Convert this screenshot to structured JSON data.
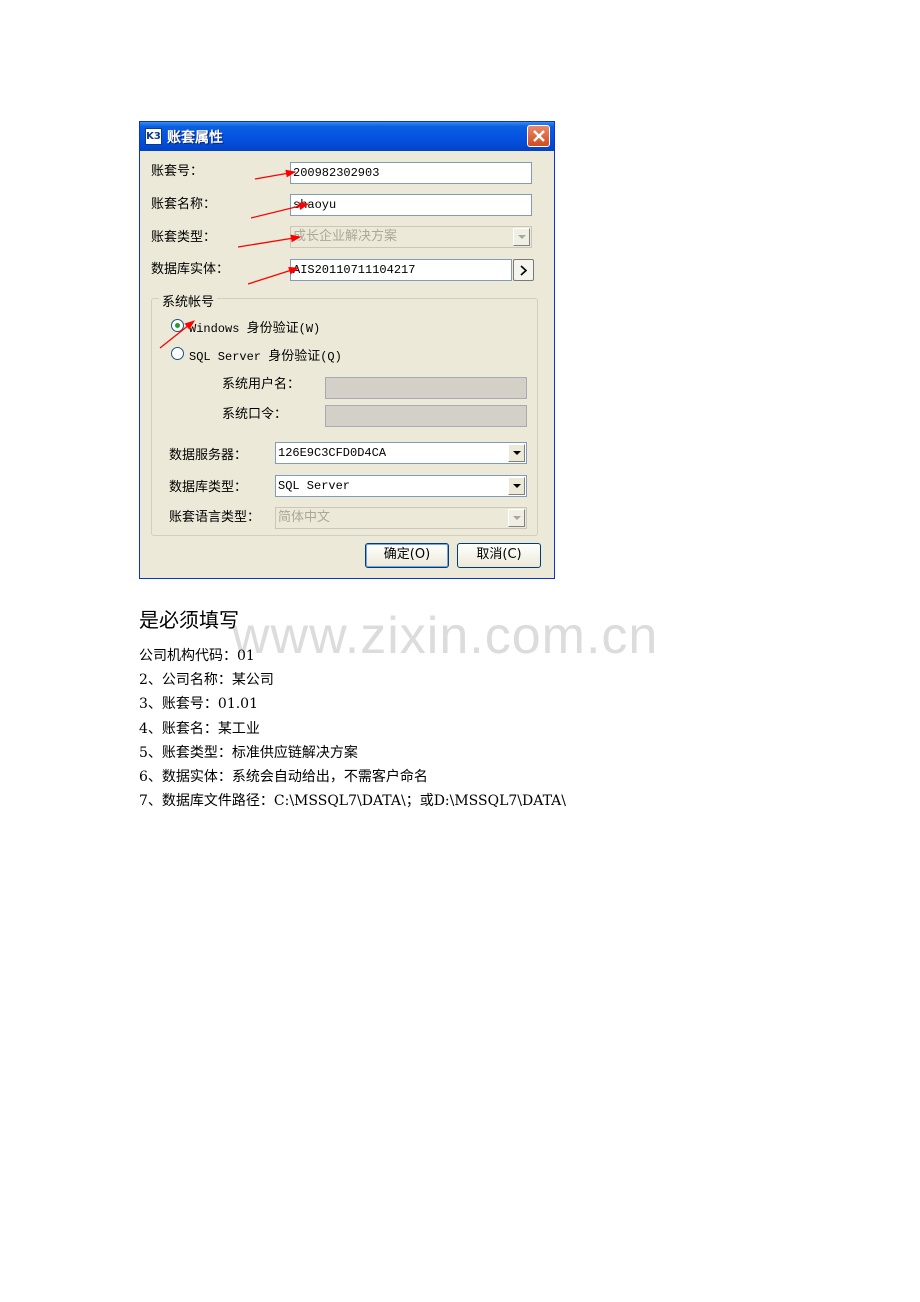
{
  "dialog": {
    "title": "账套属性",
    "app_icon_text": "K3",
    "colors": {
      "titlebar": "#0451e0",
      "close": "#d24a20",
      "body": "#ece9d8",
      "arrow": "#ff0000"
    },
    "fields": {
      "account_no_label": "账套号：",
      "account_no_value": "200982302903",
      "account_name_label": "账套名称：",
      "account_name_value": "shaoyu",
      "account_type_label": "账套类型：",
      "account_type_value": "成长企业解决方案",
      "db_entity_label": "数据库实体：",
      "db_entity_value": "AIS20110711104217"
    },
    "system_account": {
      "legend": "系统帐号",
      "windows_auth": {
        "en": "Windows ",
        "cn": "身份验证",
        "key": "(W)",
        "selected": true
      },
      "sql_auth": {
        "en": "SQL Server ",
        "cn": "身份验证",
        "key": "(Q)",
        "selected": false
      },
      "user_label": "系统用户名：",
      "password_label": "系统口令：",
      "server_label": "数据服务器：",
      "server_value": "126E9C3CFD0D4CA",
      "db_type_label": "数据库类型：",
      "db_type_value": "SQL Server",
      "lang_label": "账套语言类型：",
      "lang_value": "简体中文"
    },
    "buttons": {
      "ok": "确定(O)",
      "cancel": "取消(C)"
    }
  },
  "watermark": "www.zixin.com.cn",
  "heading": "是必须填写",
  "notes": [
    "公司机构代码：01",
    "2、公司名称：某公司",
    "3、账套号：01.01",
    "4、账套名：某工业",
    "5、账套类型：标准供应链解决方案",
    "6、数据实体：系统会自动给出，不需客户命名",
    "7、数据库文件路径：C:\\MSSQL7\\DATA\\；或D:\\MSSQL7\\DATA\\"
  ]
}
